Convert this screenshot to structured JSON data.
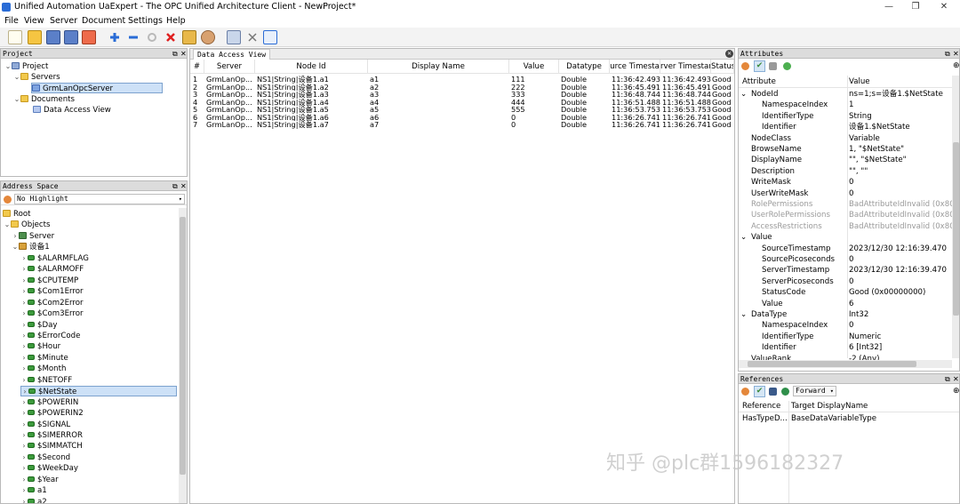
{
  "window": {
    "title": "Unified Automation UaExpert - The OPC Unified Architecture Client - NewProject*",
    "minimize": "—",
    "maximize": "❐",
    "close": "✕"
  },
  "menu": [
    "File",
    "View",
    "Server",
    "Document",
    "Settings",
    "Help"
  ],
  "project_panel": {
    "title": "Project",
    "pin": "⧉",
    "close": "✕",
    "tree": {
      "root": "Project",
      "servers": "Servers",
      "server_item": "GrmLanOpcServer",
      "documents": "Documents",
      "document_item": "Data Access View"
    }
  },
  "address_panel": {
    "title": "Address Space",
    "highlight": "No Highlight",
    "root": "Root",
    "objects": "Objects",
    "server": "Server",
    "device": "设备1",
    "items": [
      "$ALARMFLAG",
      "$ALARMOFF",
      "$CPUTEMP",
      "$Com1Error",
      "$Com2Error",
      "$Com3Error",
      "$Day",
      "$ErrorCode",
      "$Hour",
      "$Minute",
      "$Month",
      "$NETOFF",
      "$NetState",
      "$POWERIN",
      "$POWERIN2",
      "$SIGNAL",
      "$SIMERROR",
      "$SIMMATCH",
      "$Second",
      "$WeekDay",
      "$Year",
      "a1",
      "a2"
    ],
    "selected_item": "$NetState"
  },
  "dav": {
    "tab": "Data Access View",
    "columns": [
      "#",
      "Server",
      "Node Id",
      "Display Name",
      "Value",
      "Datatype",
      "urce Timesta",
      "rver Timestar",
      "Status"
    ],
    "rows": [
      [
        "1",
        "GrmLanOp...",
        "NS1|String|设备1.a1",
        "a1",
        "111",
        "Double",
        "11:36:42.493",
        "11:36:42.493",
        "Good"
      ],
      [
        "2",
        "GrmLanOp...",
        "NS1|String|设备1.a2",
        "a2",
        "222",
        "Double",
        "11:36:45.491",
        "11:36:45.491",
        "Good"
      ],
      [
        "3",
        "GrmLanOp...",
        "NS1|String|设备1.a3",
        "a3",
        "333",
        "Double",
        "11:36:48.744",
        "11:36:48.744",
        "Good"
      ],
      [
        "4",
        "GrmLanOp...",
        "NS1|String|设备1.a4",
        "a4",
        "444",
        "Double",
        "11:36:51.488",
        "11:36:51.488",
        "Good"
      ],
      [
        "5",
        "GrmLanOp...",
        "NS1|String|设备1.a5",
        "a5",
        "555",
        "Double",
        "11:36:53.753",
        "11:36:53.753",
        "Good"
      ],
      [
        "6",
        "GrmLanOp...",
        "NS1|String|设备1.a6",
        "a6",
        "0",
        "Double",
        "11:36:26.741",
        "11:36:26.741",
        "Good"
      ],
      [
        "7",
        "GrmLanOp...",
        "NS1|String|设备1.a7",
        "a7",
        "0",
        "Double",
        "11:36:26.741",
        "11:36:26.741",
        "Good"
      ]
    ]
  },
  "attributes": {
    "title": "Attributes",
    "col_attribute": "Attribute",
    "col_value": "Value",
    "rows": [
      {
        "name": "NodeId",
        "value": "ns=1;s=设备1.$NetState",
        "level": 1,
        "expander": "v",
        "bad": false
      },
      {
        "name": "NamespaceIndex",
        "value": "1",
        "level": 2,
        "expander": "",
        "bad": false
      },
      {
        "name": "IdentifierType",
        "value": "String",
        "level": 2,
        "expander": "",
        "bad": false
      },
      {
        "name": "Identifier",
        "value": "设备1.$NetState",
        "level": 2,
        "expander": "",
        "bad": false
      },
      {
        "name": "NodeClass",
        "value": "Variable",
        "level": 1,
        "expander": "",
        "bad": false
      },
      {
        "name": "BrowseName",
        "value": "1, \"$NetState\"",
        "level": 1,
        "expander": "",
        "bad": false
      },
      {
        "name": "DisplayName",
        "value": "\"\", \"$NetState\"",
        "level": 1,
        "expander": "",
        "bad": false
      },
      {
        "name": "Description",
        "value": "\"\", \"\"",
        "level": 1,
        "expander": "",
        "bad": false
      },
      {
        "name": "WriteMask",
        "value": "0",
        "level": 1,
        "expander": "",
        "bad": false
      },
      {
        "name": "UserWriteMask",
        "value": "0",
        "level": 1,
        "expander": "",
        "bad": false
      },
      {
        "name": "RolePermissions",
        "value": "BadAttributeIdInvalid (0x80...",
        "level": 1,
        "expander": "",
        "bad": true
      },
      {
        "name": "UserRolePermissions",
        "value": "BadAttributeIdInvalid (0x80...",
        "level": 1,
        "expander": "",
        "bad": true
      },
      {
        "name": "AccessRestrictions",
        "value": "BadAttributeIdInvalid (0x80...",
        "level": 1,
        "expander": "",
        "bad": true
      },
      {
        "name": "Value",
        "value": "",
        "level": 1,
        "expander": "v",
        "bad": false
      },
      {
        "name": "SourceTimestamp",
        "value": "2023/12/30 12:16:39.470",
        "level": 2,
        "expander": "",
        "bad": false
      },
      {
        "name": "SourcePicoseconds",
        "value": "0",
        "level": 2,
        "expander": "",
        "bad": false
      },
      {
        "name": "ServerTimestamp",
        "value": "2023/12/30 12:16:39.470",
        "level": 2,
        "expander": "",
        "bad": false
      },
      {
        "name": "ServerPicoseconds",
        "value": "0",
        "level": 2,
        "expander": "",
        "bad": false
      },
      {
        "name": "StatusCode",
        "value": "Good (0x00000000)",
        "level": 2,
        "expander": "",
        "bad": false
      },
      {
        "name": "Value",
        "value": "6",
        "level": 2,
        "expander": "",
        "bad": false
      },
      {
        "name": "DataType",
        "value": "Int32",
        "level": 1,
        "expander": "v",
        "bad": false
      },
      {
        "name": "NamespaceIndex",
        "value": "0",
        "level": 2,
        "expander": "",
        "bad": false
      },
      {
        "name": "IdentifierType",
        "value": "Numeric",
        "level": 2,
        "expander": "",
        "bad": false
      },
      {
        "name": "Identifier",
        "value": "6 [Int32]",
        "level": 2,
        "expander": "",
        "bad": false
      },
      {
        "name": "ValueRank",
        "value": "-2 (Any)",
        "level": 1,
        "expander": "",
        "bad": false
      }
    ]
  },
  "references": {
    "title": "References",
    "direction": "Forward",
    "col_reference": "Reference",
    "col_target": "Target DisplayName",
    "rows": [
      [
        "HasTypeD...",
        "BaseDataVariableType"
      ]
    ]
  },
  "watermark": "知乎 @plc群1596182327"
}
